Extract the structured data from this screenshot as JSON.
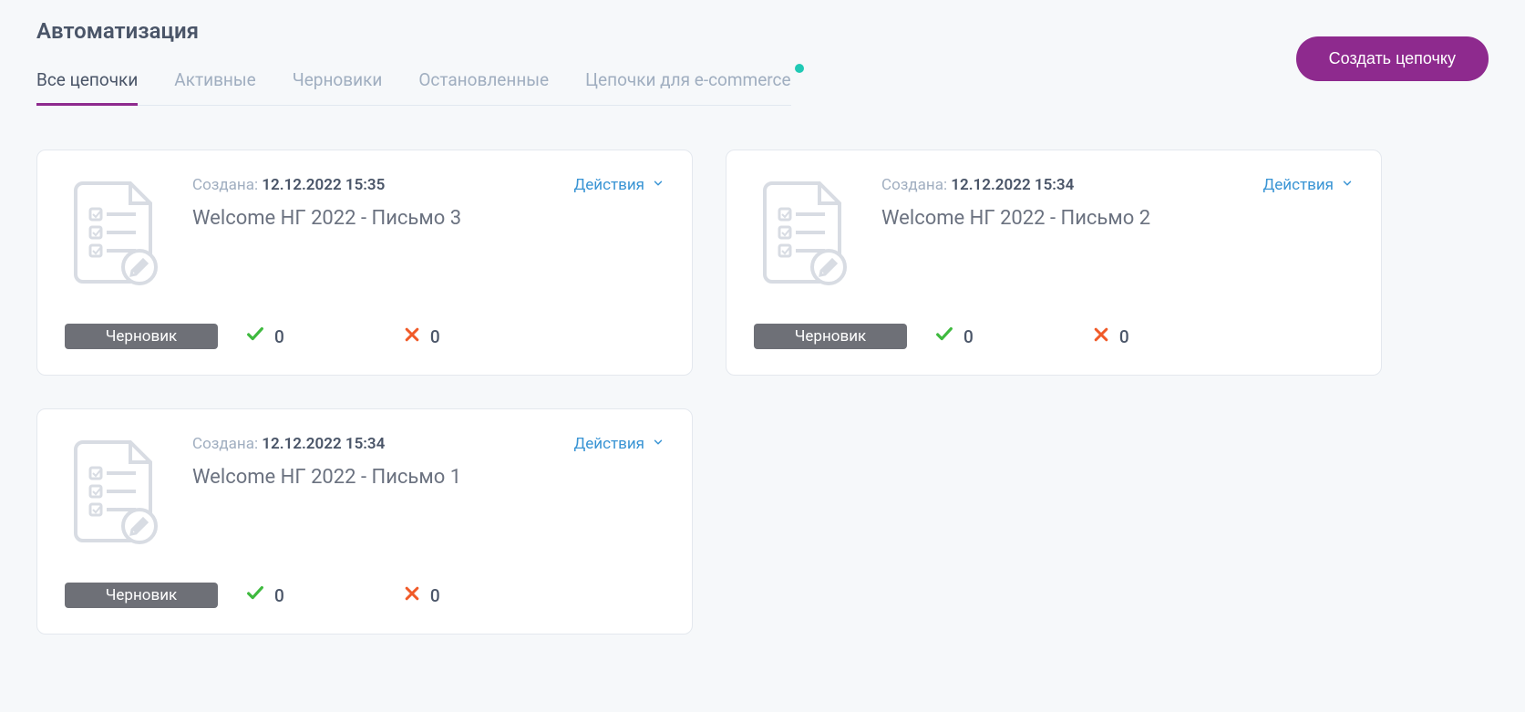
{
  "page_title": "Автоматизация",
  "create_button": "Создать цепочку",
  "tabs": [
    {
      "label": "Все цепочки",
      "active": true,
      "dot": false
    },
    {
      "label": "Активные",
      "active": false,
      "dot": false
    },
    {
      "label": "Черновики",
      "active": false,
      "dot": false
    },
    {
      "label": "Остановленные",
      "active": false,
      "dot": false
    },
    {
      "label": "Цепочки для e-commerce",
      "active": false,
      "dot": true
    }
  ],
  "labels": {
    "created": "Создана:",
    "actions": "Действия",
    "draft_badge": "Черновик"
  },
  "cards": [
    {
      "created": "12.12.2022 15:35",
      "title": "Welcome НГ 2022 - Письмо 3",
      "status": "Черновик",
      "success": 0,
      "fail": 0
    },
    {
      "created": "12.12.2022 15:34",
      "title": "Welcome НГ 2022 - Письмо 2",
      "status": "Черновик",
      "success": 0,
      "fail": 0
    },
    {
      "created": "12.12.2022 15:34",
      "title": "Welcome НГ 2022 - Письмо 1",
      "status": "Черновик",
      "success": 0,
      "fail": 0
    }
  ]
}
